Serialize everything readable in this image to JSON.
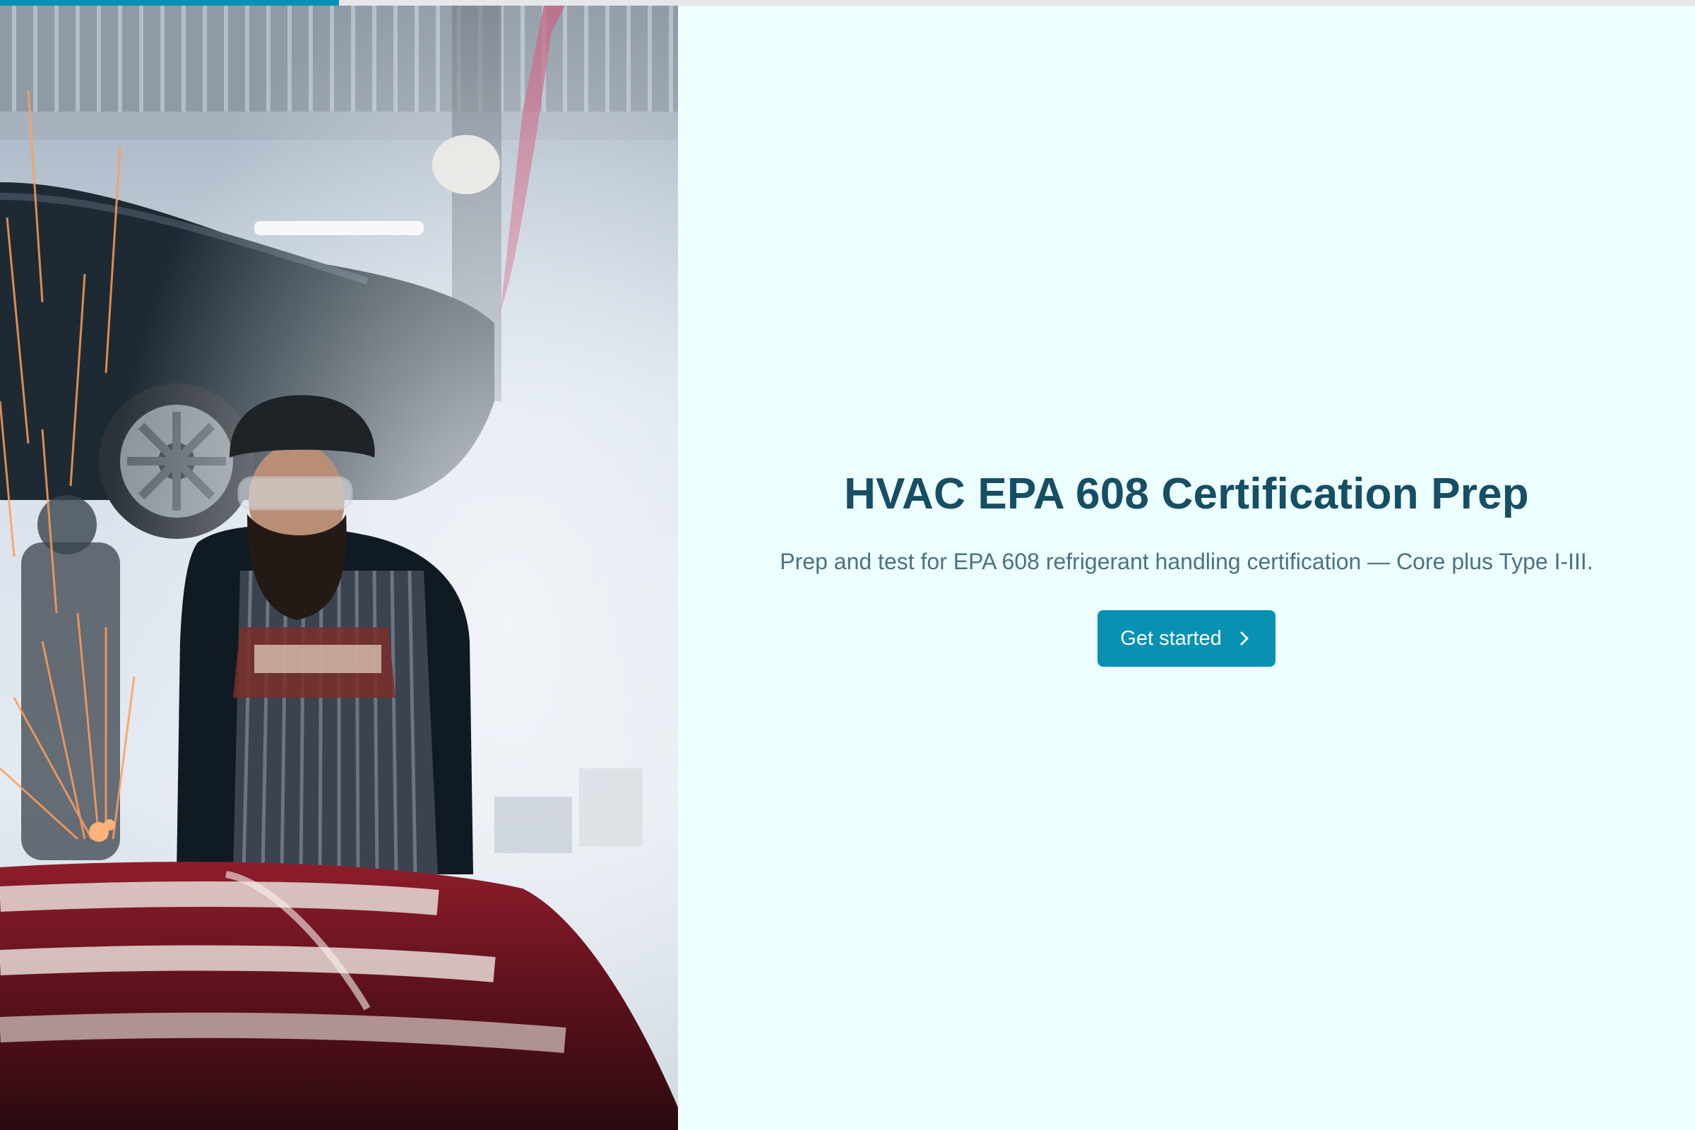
{
  "progress": {
    "fraction": 0.2,
    "color": "#0891b2",
    "track_color": "#e5e7eb"
  },
  "hero": {
    "image": "mechanic-grinding-sparks-garage-photo"
  },
  "main": {
    "title": "HVAC EPA 608 Certification Prep",
    "subtitle": "Prep and test for EPA 608 refrigerant handling certification — Core plus Type I-III.",
    "cta_label": "Get started",
    "cta_icon": "chevron-right-icon"
  },
  "colors": {
    "background": "#ecfeff",
    "title": "#164e63",
    "subtitle": "#4b7280",
    "accent": "#0891b2"
  }
}
